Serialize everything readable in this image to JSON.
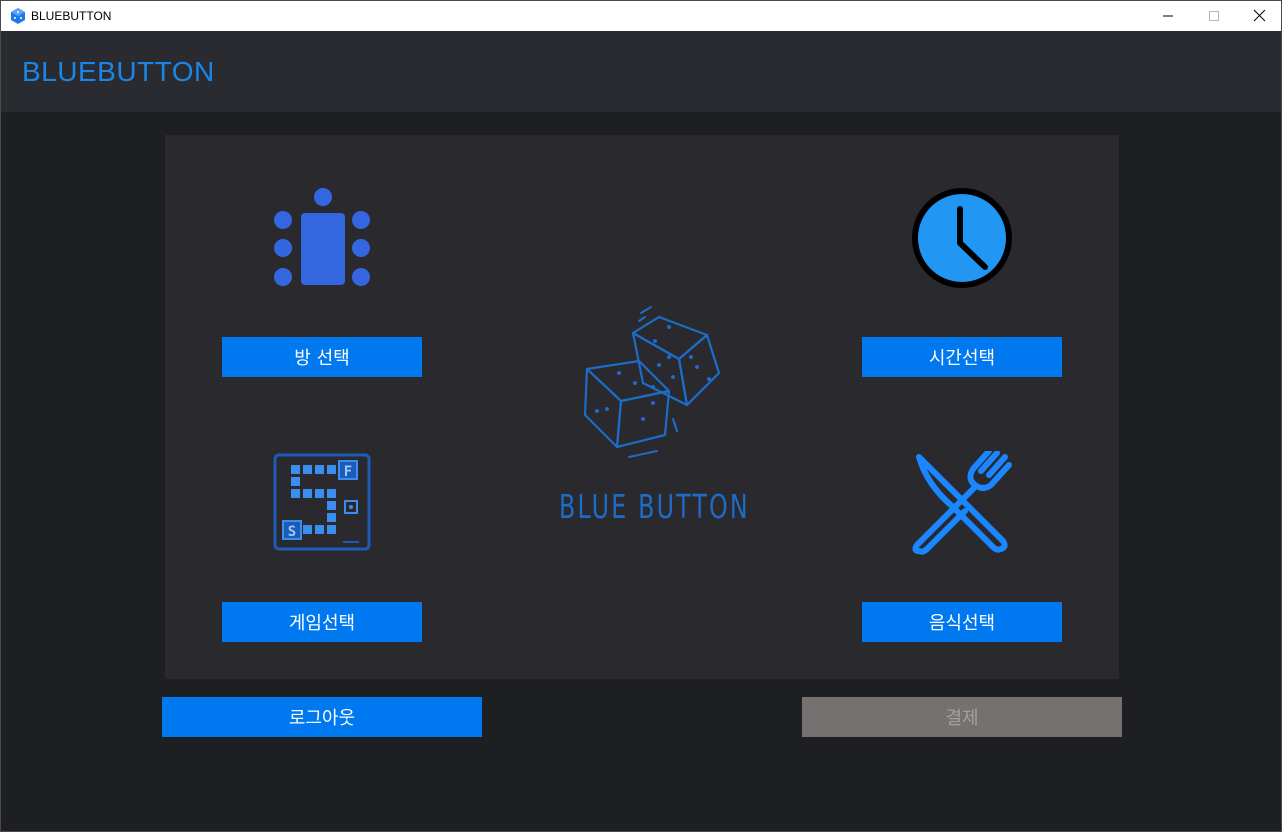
{
  "window": {
    "title": "BLUEBUTTON"
  },
  "header": {
    "title": "BLUEBUTTON"
  },
  "logo": {
    "text": "BLUE BUTTON"
  },
  "menu": {
    "room": {
      "label": "방 선택",
      "icon": "room-table-icon"
    },
    "time": {
      "label": "시간선택",
      "icon": "clock-icon"
    },
    "game": {
      "label": "게임선택",
      "icon": "board-game-icon"
    },
    "food": {
      "label": "음식선택",
      "icon": "fork-knife-icon"
    }
  },
  "footer": {
    "logout_label": "로그아웃",
    "pay_label": "결제",
    "pay_enabled": false
  },
  "colors": {
    "accent": "#0078f0",
    "disabled": "#747170",
    "background": "#1e1f22",
    "panel": "#29292e"
  }
}
